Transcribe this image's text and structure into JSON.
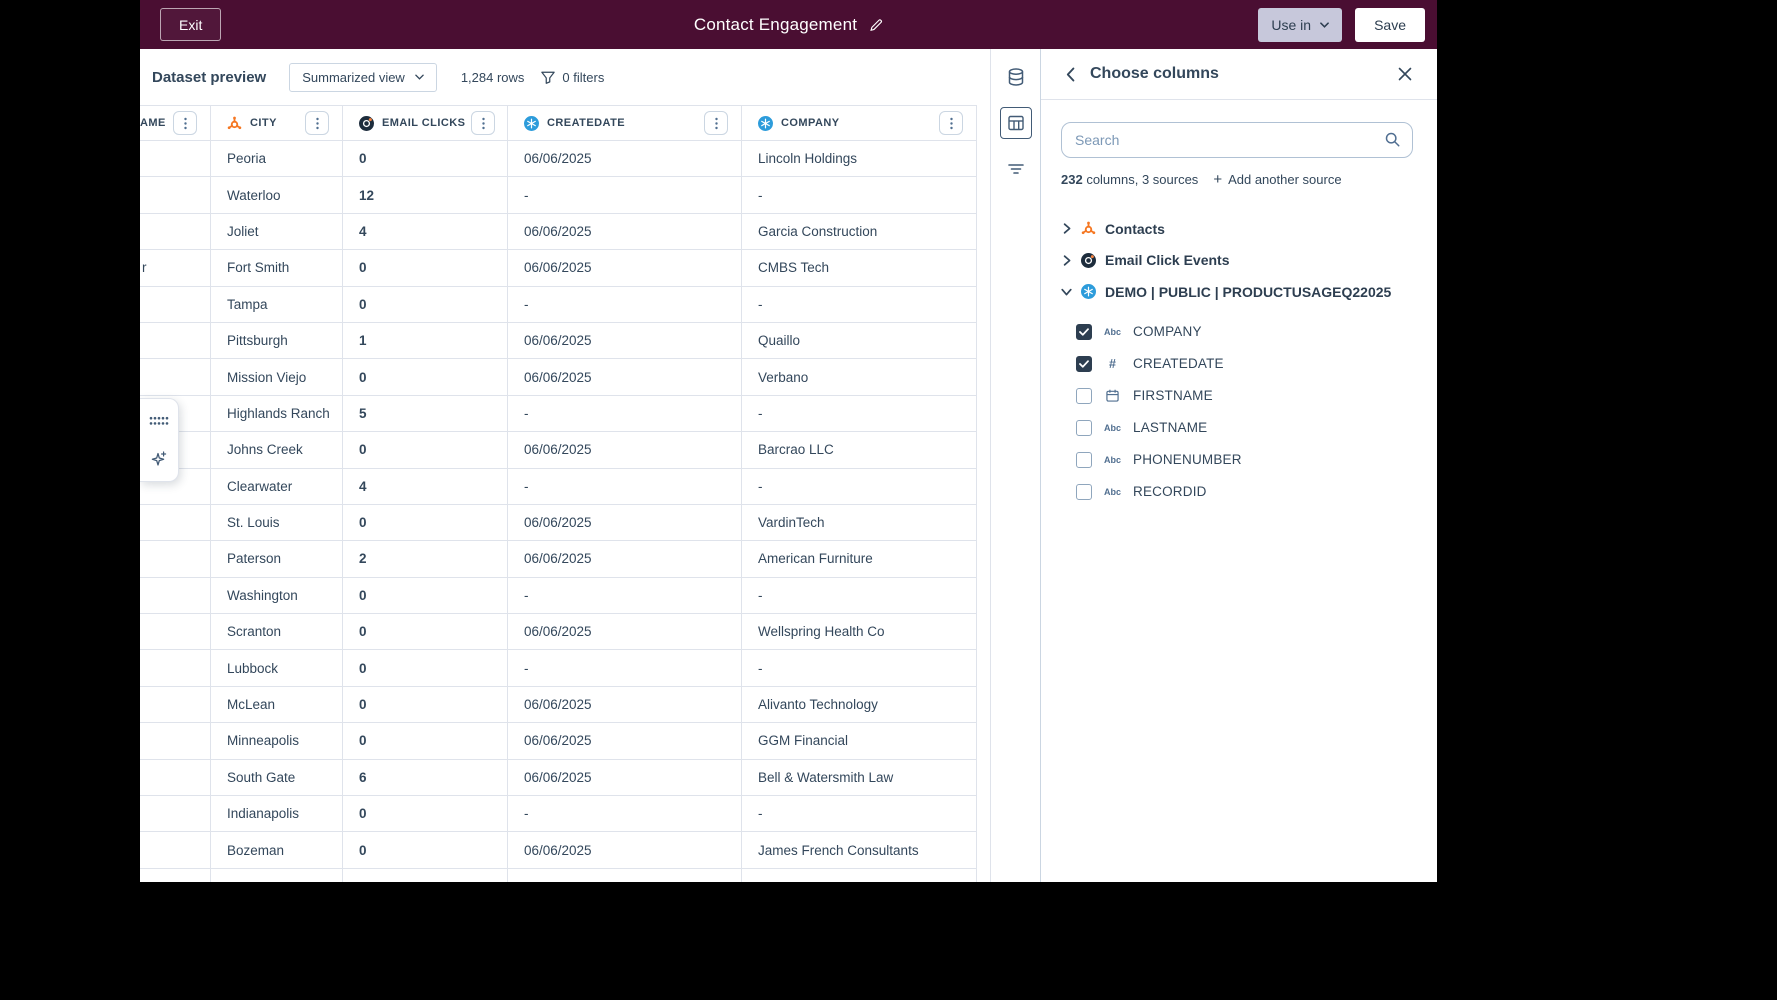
{
  "topbar": {
    "exit_label": "Exit",
    "title": "Contact Engagement",
    "use_in_label": "Use in",
    "save_label": "Save"
  },
  "preview": {
    "heading": "Dataset preview",
    "view_selector": "Summarized view",
    "row_count": "1,284 rows",
    "filters_label": "0 filters"
  },
  "table": {
    "columns": [
      {
        "label": "AME",
        "icon": "none"
      },
      {
        "label": "CITY",
        "icon": "hubspot-sprocket-icon"
      },
      {
        "label": "EMAIL CLICKS",
        "icon": "email-click-events-icon"
      },
      {
        "label": "CREATEDATE",
        "icon": "blue-source-icon"
      },
      {
        "label": "COMPANY",
        "icon": "blue-source-icon"
      }
    ],
    "rows": [
      {
        "name": "",
        "city": "Peoria",
        "email_clicks": "0",
        "createdate": "06/06/2025",
        "company": "Lincoln Holdings"
      },
      {
        "name": "",
        "city": "Waterloo",
        "email_clicks": "12",
        "createdate": "-",
        "company": "-"
      },
      {
        "name": "",
        "city": "Joliet",
        "email_clicks": "4",
        "createdate": "06/06/2025",
        "company": "Garcia Construction"
      },
      {
        "name": "r",
        "city": "Fort Smith",
        "email_clicks": "0",
        "createdate": "06/06/2025",
        "company": "CMBS Tech"
      },
      {
        "name": "",
        "city": "Tampa",
        "email_clicks": "0",
        "createdate": "-",
        "company": "-"
      },
      {
        "name": "",
        "city": "Pittsburgh",
        "email_clicks": "1",
        "createdate": "06/06/2025",
        "company": "Quaillo"
      },
      {
        "name": "",
        "city": "Mission Viejo",
        "email_clicks": "0",
        "createdate": "06/06/2025",
        "company": "Verbano"
      },
      {
        "name": "",
        "city": "Highlands Ranch",
        "email_clicks": "5",
        "createdate": "-",
        "company": "-"
      },
      {
        "name": "",
        "city": "Johns Creek",
        "email_clicks": "0",
        "createdate": "06/06/2025",
        "company": "Barcrao LLC"
      },
      {
        "name": "",
        "city": "Clearwater",
        "email_clicks": "4",
        "createdate": "-",
        "company": "-"
      },
      {
        "name": "",
        "city": "St. Louis",
        "email_clicks": "0",
        "createdate": "06/06/2025",
        "company": "VardinTech"
      },
      {
        "name": "",
        "city": "Paterson",
        "email_clicks": "2",
        "createdate": "06/06/2025",
        "company": "American Furniture"
      },
      {
        "name": "",
        "city": "Washington",
        "email_clicks": "0",
        "createdate": "-",
        "company": "-"
      },
      {
        "name": "",
        "city": "Scranton",
        "email_clicks": "0",
        "createdate": "06/06/2025",
        "company": "Wellspring Health Co"
      },
      {
        "name": "",
        "city": "Lubbock",
        "email_clicks": "0",
        "createdate": "-",
        "company": "-"
      },
      {
        "name": "",
        "city": "McLean",
        "email_clicks": "0",
        "createdate": "06/06/2025",
        "company": "Alivanto Technology"
      },
      {
        "name": "",
        "city": "Minneapolis",
        "email_clicks": "0",
        "createdate": "06/06/2025",
        "company": "GGM Financial"
      },
      {
        "name": "",
        "city": "South Gate",
        "email_clicks": "6",
        "createdate": "06/06/2025",
        "company": "Bell & Watersmith Law"
      },
      {
        "name": "",
        "city": "Indianapolis",
        "email_clicks": "0",
        "createdate": "-",
        "company": "-"
      },
      {
        "name": "",
        "city": "Bozeman",
        "email_clicks": "0",
        "createdate": "06/06/2025",
        "company": "James French Consultants"
      }
    ]
  },
  "rail": {
    "buttons": [
      {
        "icon": "database-icon",
        "active": false
      },
      {
        "icon": "table-icon",
        "active": true
      },
      {
        "icon": "filter-lines-icon",
        "active": false
      }
    ]
  },
  "panel": {
    "title": "Choose columns",
    "search_placeholder": "Search",
    "meta_count": "232",
    "meta_rest": " columns, 3 sources",
    "add_source_label": "Add another source",
    "sources": [
      {
        "label": "Contacts",
        "icon": "hubspot-sprocket-icon",
        "expanded": false
      },
      {
        "label": "Email Click Events",
        "icon": "email-click-events-icon",
        "expanded": false
      },
      {
        "label": "DEMO | PUBLIC | PRODUCTUSAGEQ22025",
        "icon": "blue-source-icon",
        "expanded": true
      }
    ],
    "columns": [
      {
        "label": "COMPANY",
        "type_icon": "abc",
        "checked": true
      },
      {
        "label": "CREATEDATE",
        "type_icon": "hash",
        "checked": true
      },
      {
        "label": "FIRSTNAME",
        "type_icon": "calendar",
        "checked": false
      },
      {
        "label": "LASTNAME",
        "type_icon": "abc",
        "checked": false
      },
      {
        "label": "PHONENUMBER",
        "type_icon": "abc",
        "checked": false
      },
      {
        "label": "RECORDID",
        "type_icon": "abc",
        "checked": false
      }
    ]
  },
  "colors": {
    "topbar_bg": "#4a0e32",
    "hubspot_orange": "#f57722",
    "source_blue": "#2d9cdb",
    "dark_source": "#1d2c3c",
    "text": "#33475b",
    "border": "#dfe3eb",
    "use_in_bg": "#c7c8db",
    "checkbox_checked": "#2d3e50"
  }
}
